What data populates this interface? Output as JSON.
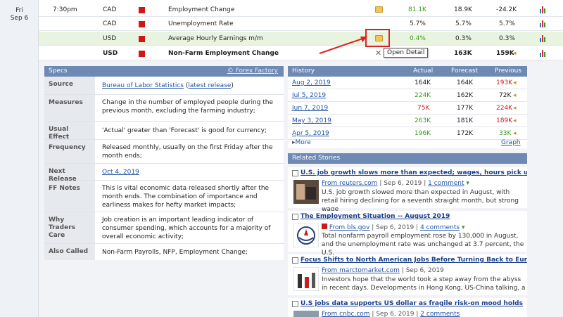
{
  "date": {
    "day": "Fri",
    "date": "Sep 6"
  },
  "events": [
    {
      "time": "7:30pm",
      "currency": "CAD",
      "name": "Employment Change",
      "actual": "81.1K",
      "actual_color": "green",
      "forecast": "18.9K",
      "previous": "-24.2K",
      "bold": false,
      "highlight": false
    },
    {
      "time": "",
      "currency": "CAD",
      "name": "Unemployment Rate",
      "actual": "5.7%",
      "actual_color": "neutral",
      "forecast": "5.7%",
      "previous": "5.7%",
      "bold": false,
      "highlight": false
    },
    {
      "time": "",
      "currency": "USD",
      "name": "Average Hourly Earnings m/m",
      "actual": "0.4%",
      "actual_color": "green",
      "forecast": "0.3%",
      "previous": "0.3%",
      "bold": false,
      "highlight": true
    },
    {
      "time": "",
      "currency": "USD",
      "name": "Non-Farm Employment Change",
      "actual": "",
      "actual_color": "neutral",
      "forecast": "163K",
      "previous": "159K",
      "bold": true,
      "highlight": false
    }
  ],
  "tooltip": "Open Detail",
  "specs": {
    "header": "Specs",
    "source_link": "Forex Factory",
    "rows": [
      {
        "label": "Source",
        "value": "Bureau of Labor Statistics",
        "extra_link": "latest release"
      },
      {
        "label": "Measures",
        "value": "Change in the number of employed people during the previous month, excluding the farming industry;"
      },
      {
        "label": "Usual Effect",
        "value": "'Actual' greater than 'Forecast' is good for currency;"
      },
      {
        "label": "Frequency",
        "value": "Released monthly, usually on the first Friday after the month ends;"
      },
      {
        "label": "Next Release",
        "value": "Oct 4, 2019"
      },
      {
        "label": "FF Notes",
        "value": "This is vital economic data released shortly after the month ends. The combination of importance and earliness makes for hefty market impacts;"
      },
      {
        "label": "Why Traders Care",
        "value": "Job creation is an important leading indicator of consumer spending, which accounts for a majority of overall economic activity;"
      },
      {
        "label": "Also Called",
        "value": "Non-Farm Payrolls, NFP, Employment Change;"
      }
    ]
  },
  "history": {
    "header": "History",
    "col_actual": "Actual",
    "col_forecast": "Forecast",
    "col_previous": "Previous",
    "rows": [
      {
        "date": "Aug 2, 2019",
        "actual": "164K",
        "actual_color": "neutral",
        "forecast": "164K",
        "previous": "193K",
        "prev_color": "red"
      },
      {
        "date": "Jul 5, 2019",
        "actual": "224K",
        "actual_color": "green",
        "forecast": "162K",
        "previous": "72K",
        "prev_color": "neutral"
      },
      {
        "date": "Jun 7, 2019",
        "actual": "75K",
        "actual_color": "red",
        "forecast": "177K",
        "previous": "224K",
        "prev_color": "red"
      },
      {
        "date": "May 3, 2019",
        "actual": "263K",
        "actual_color": "green",
        "forecast": "181K",
        "previous": "189K",
        "prev_color": "red"
      },
      {
        "date": "Apr 5, 2019",
        "actual": "196K",
        "actual_color": "green",
        "forecast": "172K",
        "previous": "33K",
        "prev_color": "green"
      }
    ],
    "more": "More",
    "graph": "Graph"
  },
  "stories": {
    "header": "Related Stories",
    "items": [
      {
        "title": "U.S. job growth slows more than expected; wages, hours pick up",
        "source": "From reuters.com",
        "date": "Sep 6, 2019",
        "comments": "1 comment",
        "summary": "U.S. job growth slowed more than expected in August, with retail hiring declining for a seventh straight month, but strong wage"
      },
      {
        "title": "The Employment Situation -- August 2019",
        "source": "From bls.gov",
        "date": "Sep 6, 2019",
        "comments": "4 comments",
        "summary": "Total nonfarm payroll employment rose by 130,000 in August, and the unemployment rate was unchanged at 3.7 percent, the U.S."
      },
      {
        "title": "Focus Shifts to North American Jobs Before Turning Back to Europe",
        "source": "From marctomarket.com",
        "date": "Sep 6, 2019",
        "comments": "",
        "summary": "Investors hope that the world took a step away from the abyss in recent days. Developments in Hong Kong, US-China talking, a"
      },
      {
        "title": "U.S jobs data supports US dollar as fragile risk-on mood holds",
        "source": "From cnbc.com",
        "date": "Sep 6, 2019",
        "comments": "2 comments",
        "summary": ""
      }
    ]
  },
  "colors": {
    "green": "#3a9b1a",
    "red": "#d01c1c",
    "header": "#6d89b4",
    "highlight_box": "#e02020"
  }
}
